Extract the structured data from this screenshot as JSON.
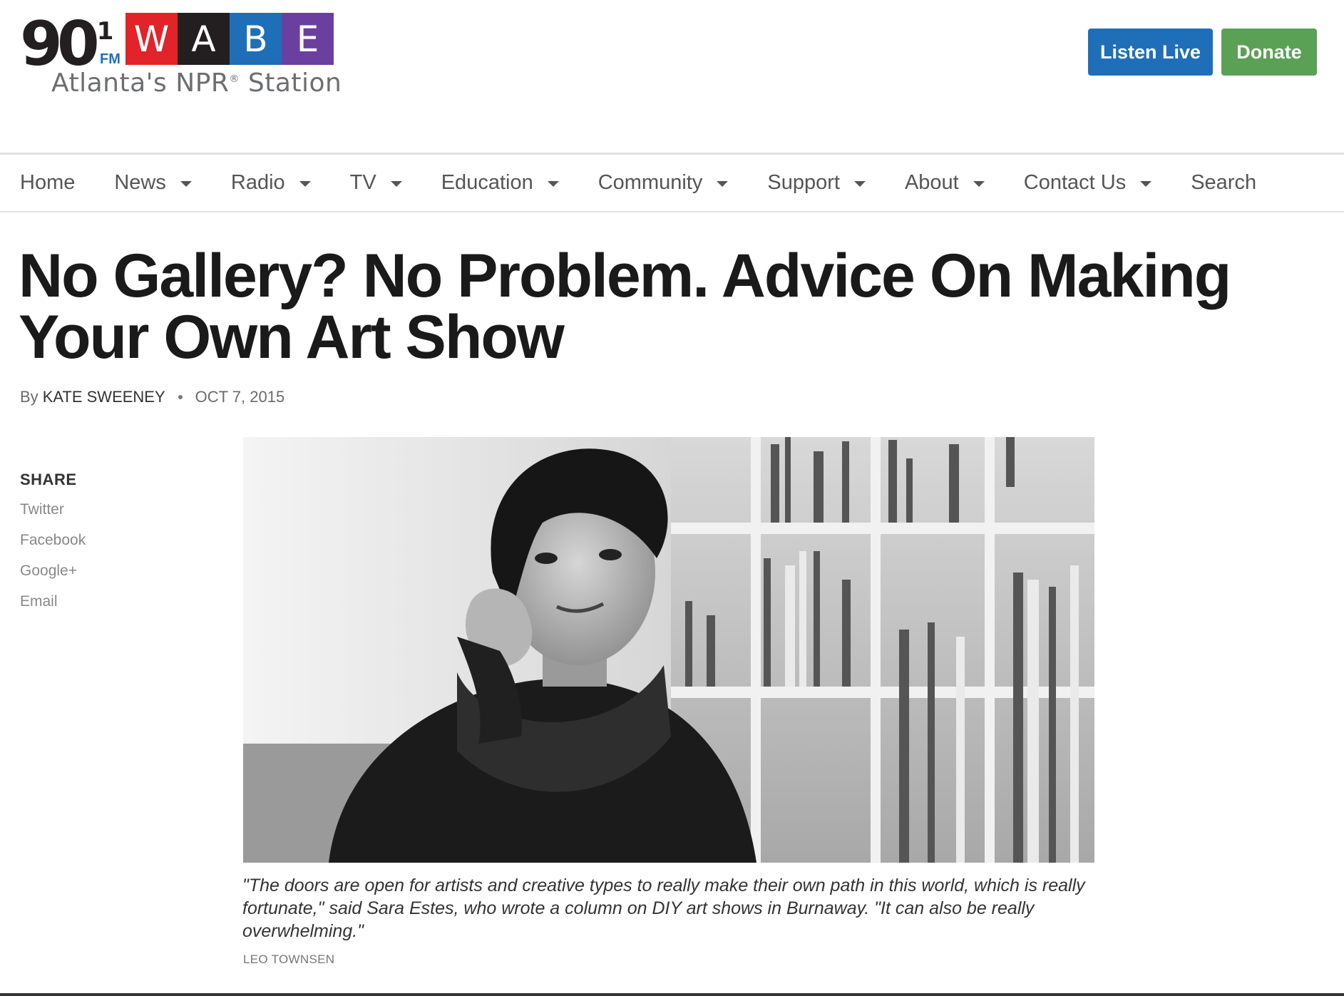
{
  "header": {
    "logo": {
      "number": "90",
      "number_sup": "1",
      "fm": "FM",
      "letters": [
        {
          "char": "W",
          "color": "#e2232a"
        },
        {
          "char": "A",
          "color": "#231f20"
        },
        {
          "char": "B",
          "color": "#1e6fb8"
        },
        {
          "char": "E",
          "color": "#6b3fa0"
        }
      ],
      "tagline": "Atlanta's NPR",
      "tagline_reg": "®",
      "tagline_end": " Station"
    },
    "listen_live": "Listen Live",
    "donate": "Donate",
    "colors": {
      "listen": "#1f6fb8",
      "donate": "#5aa155"
    }
  },
  "nav": {
    "items": [
      {
        "label": "Home",
        "dropdown": false
      },
      {
        "label": "News",
        "dropdown": true
      },
      {
        "label": "Radio",
        "dropdown": true
      },
      {
        "label": "TV",
        "dropdown": true
      },
      {
        "label": "Education",
        "dropdown": true
      },
      {
        "label": "Community",
        "dropdown": true
      },
      {
        "label": "Support",
        "dropdown": true
      },
      {
        "label": "About",
        "dropdown": true
      },
      {
        "label": "Contact Us",
        "dropdown": true
      },
      {
        "label": "Search",
        "dropdown": false
      }
    ]
  },
  "article": {
    "headline_line1": "No Gallery? No Problem. Advice On Making",
    "headline_line2": "Your Own Art Show",
    "by_prefix": "By",
    "author": "KATE SWEENEY",
    "date": "OCT 7, 2015",
    "caption": "\"The doors are open for artists and creative types to really make their own path in this world, which is really fortunate,\" said Sara Estes, who wrote a column on DIY art shows in Burnaway. \"It can also be really overwhelming.\"",
    "credit": "LEO TOWNSEN"
  },
  "share": {
    "title": "SHARE",
    "links": [
      "Twitter",
      "Facebook",
      "Google+",
      "Email"
    ]
  }
}
